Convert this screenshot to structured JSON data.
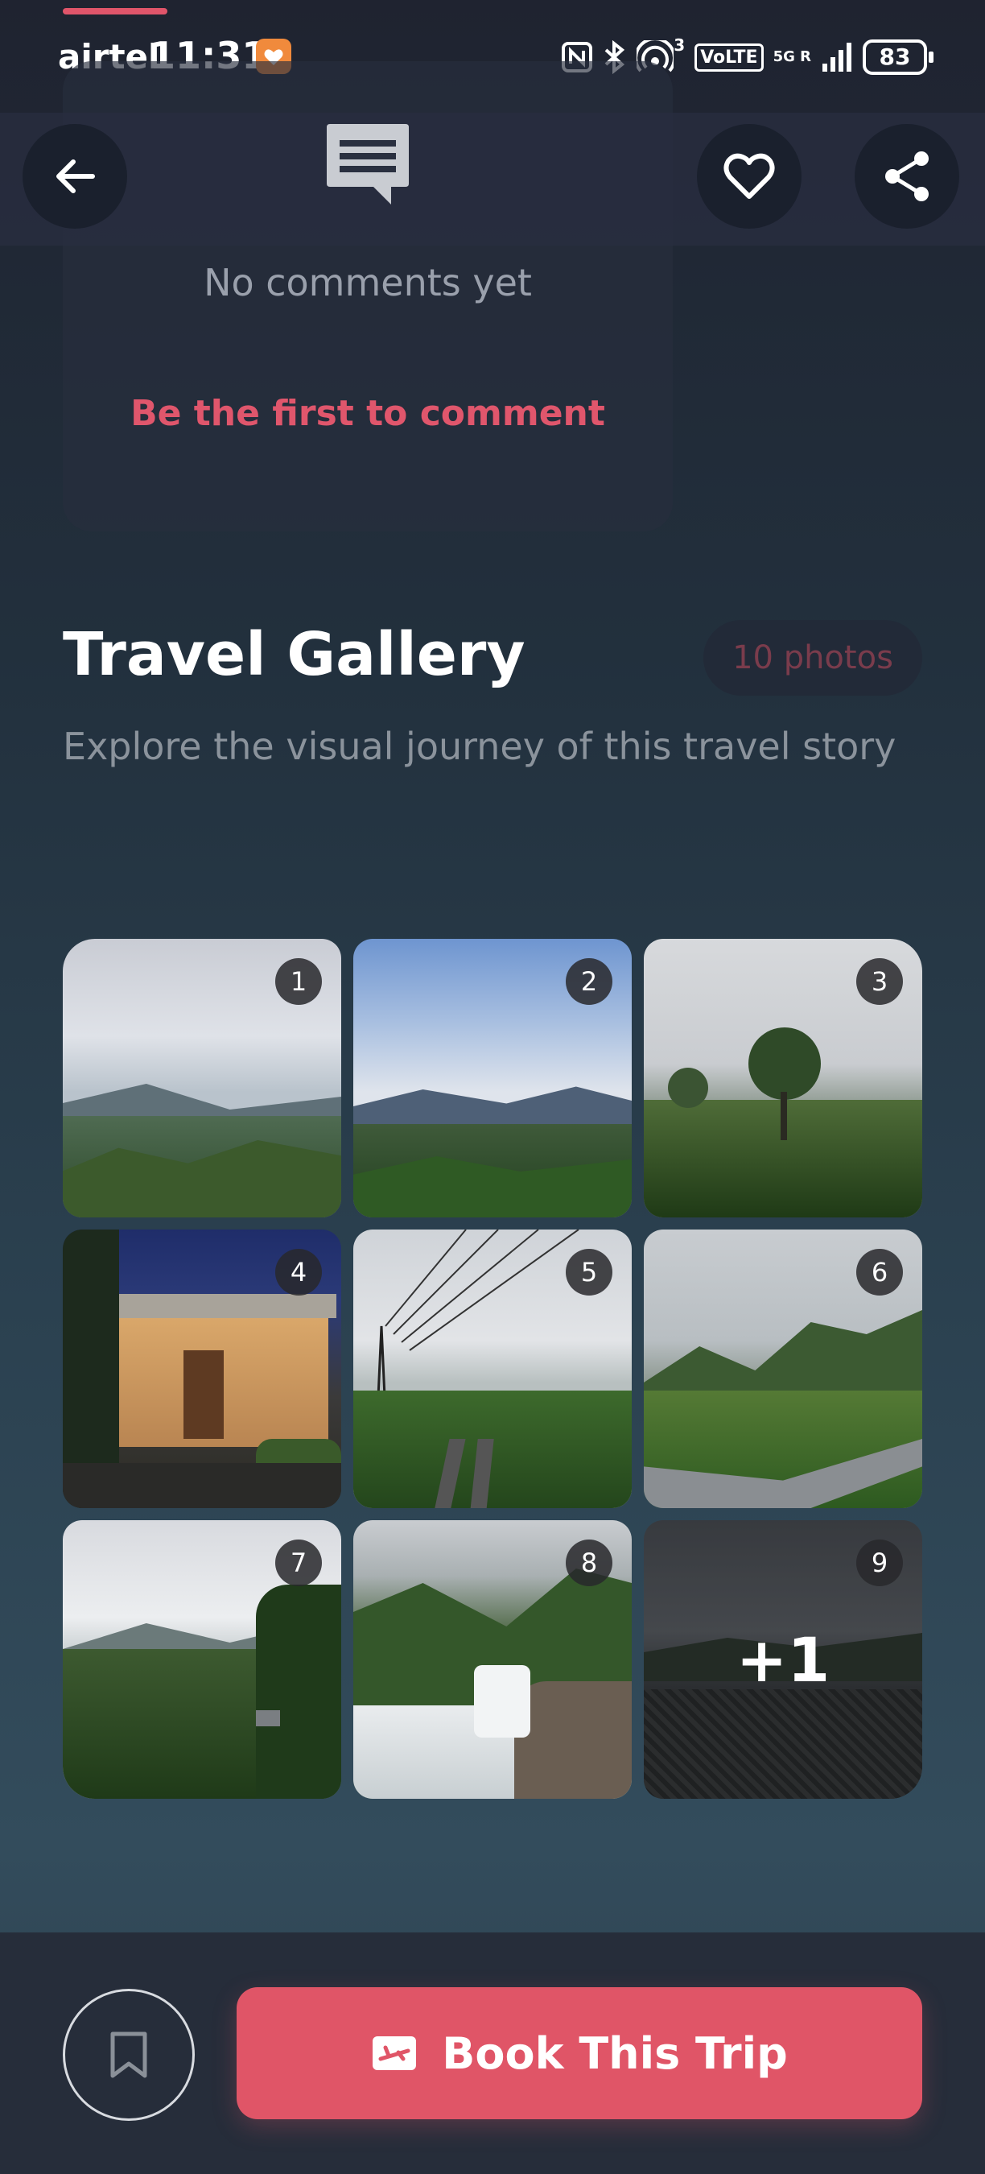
{
  "status_bar": {
    "carrier": "airtel",
    "time": "11:31",
    "network_sup": "3",
    "volte": "VoLTE",
    "fiveg_top": "5G R",
    "battery": "83"
  },
  "top_bar": {
    "back_icon": "arrow-left-icon",
    "like_icon": "heart-outline-icon",
    "share_icon": "share-icon"
  },
  "comments": {
    "icon": "comment-icon",
    "empty_text": "No comments yet",
    "cta": "Be the first to comment"
  },
  "gallery": {
    "title": "Travel Gallery",
    "count_badge": "10 photos",
    "subtitle": "Explore the visual journey of this travel story",
    "photos": [
      {
        "index": "1",
        "scene": "cloudy sky over green hills"
      },
      {
        "index": "2",
        "scene": "blue sky over mountain valley"
      },
      {
        "index": "3",
        "scene": "misty tea garden with trees"
      },
      {
        "index": "4",
        "scene": "lit building entrance at night"
      },
      {
        "index": "5",
        "scene": "power lines and pipelines in misty hills"
      },
      {
        "index": "6",
        "scene": "winding road through foggy plantation"
      },
      {
        "index": "7",
        "scene": "forested valley under clouds"
      },
      {
        "index": "8",
        "scene": "waterfall over rocks"
      },
      {
        "index": "9",
        "scene": "dark cloudy sky with fence",
        "overlay": "+1"
      }
    ]
  },
  "bottom_bar": {
    "bookmark_icon": "bookmark-icon",
    "book_icon": "flight-ticket-icon",
    "book_label": "Book This Trip"
  },
  "colors": {
    "accent": "#e05567",
    "background_top": "#1f2330",
    "background_bottom": "#334c5c"
  }
}
